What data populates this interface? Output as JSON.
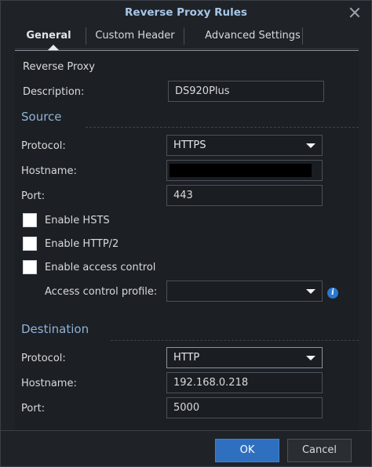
{
  "dialog": {
    "title": "Reverse Proxy Rules"
  },
  "tabs": [
    {
      "label": "General",
      "active": true
    },
    {
      "label": "Custom Header",
      "active": false
    },
    {
      "label": "Advanced Settings",
      "active": false
    }
  ],
  "general": {
    "heading": "Reverse Proxy",
    "description_label": "Description:",
    "description_value": "DS920Plus"
  },
  "source": {
    "title": "Source",
    "protocol_label": "Protocol:",
    "protocol_value": "HTTPS",
    "hostname_label": "Hostname:",
    "hostname_value": "",
    "port_label": "Port:",
    "port_value": "443",
    "hsts_label": "Enable HSTS",
    "http2_label": "Enable HTTP/2",
    "access_control_label": "Enable access control",
    "access_profile_label": "Access control profile:",
    "access_profile_value": ""
  },
  "destination": {
    "title": "Destination",
    "protocol_label": "Protocol:",
    "protocol_value": "HTTP",
    "hostname_label": "Hostname:",
    "hostname_value": "192.168.0.218",
    "port_label": "Port:",
    "port_value": "5000"
  },
  "footer": {
    "ok_label": "OK",
    "cancel_label": "Cancel"
  },
  "icons": {
    "close": "close-icon",
    "dropdown": "chevron-down-icon",
    "info": "info-icon"
  },
  "colors": {
    "accent": "#2f6fbf",
    "section_title": "#8fb2d8",
    "background": "#1f2328"
  }
}
